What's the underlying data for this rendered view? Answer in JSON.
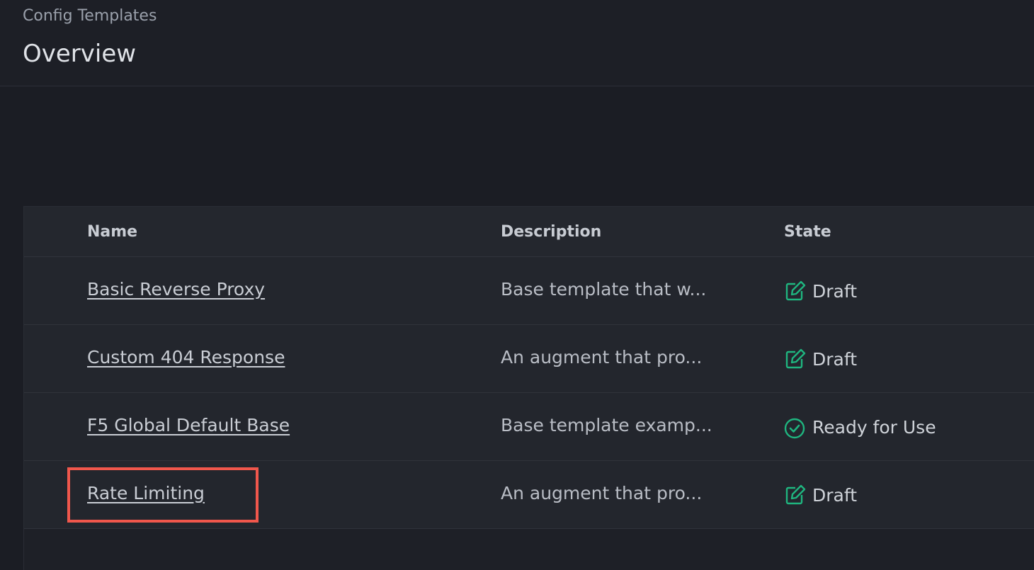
{
  "header": {
    "breadcrumb": "Config Templates",
    "title": "Overview"
  },
  "table": {
    "columns": [
      "Name",
      "Description",
      "State"
    ],
    "rows": [
      {
        "name": "Basic Reverse Proxy",
        "description": "Base template that w...",
        "state": "Draft",
        "state_icon": "edit-icon"
      },
      {
        "name": "Custom 404 Response",
        "description": "An augment that pro...",
        "state": "Draft",
        "state_icon": "edit-icon"
      },
      {
        "name": "F5 Global Default Base",
        "description": "Base template examp...",
        "state": "Ready for Use",
        "state_icon": "check-circle-icon"
      },
      {
        "name": "Rate Limiting",
        "description": "An augment that pro...",
        "state": "Draft",
        "state_icon": "edit-icon"
      }
    ]
  },
  "colors": {
    "accent_green": "#1fb57f",
    "highlight": "#f0574c"
  }
}
